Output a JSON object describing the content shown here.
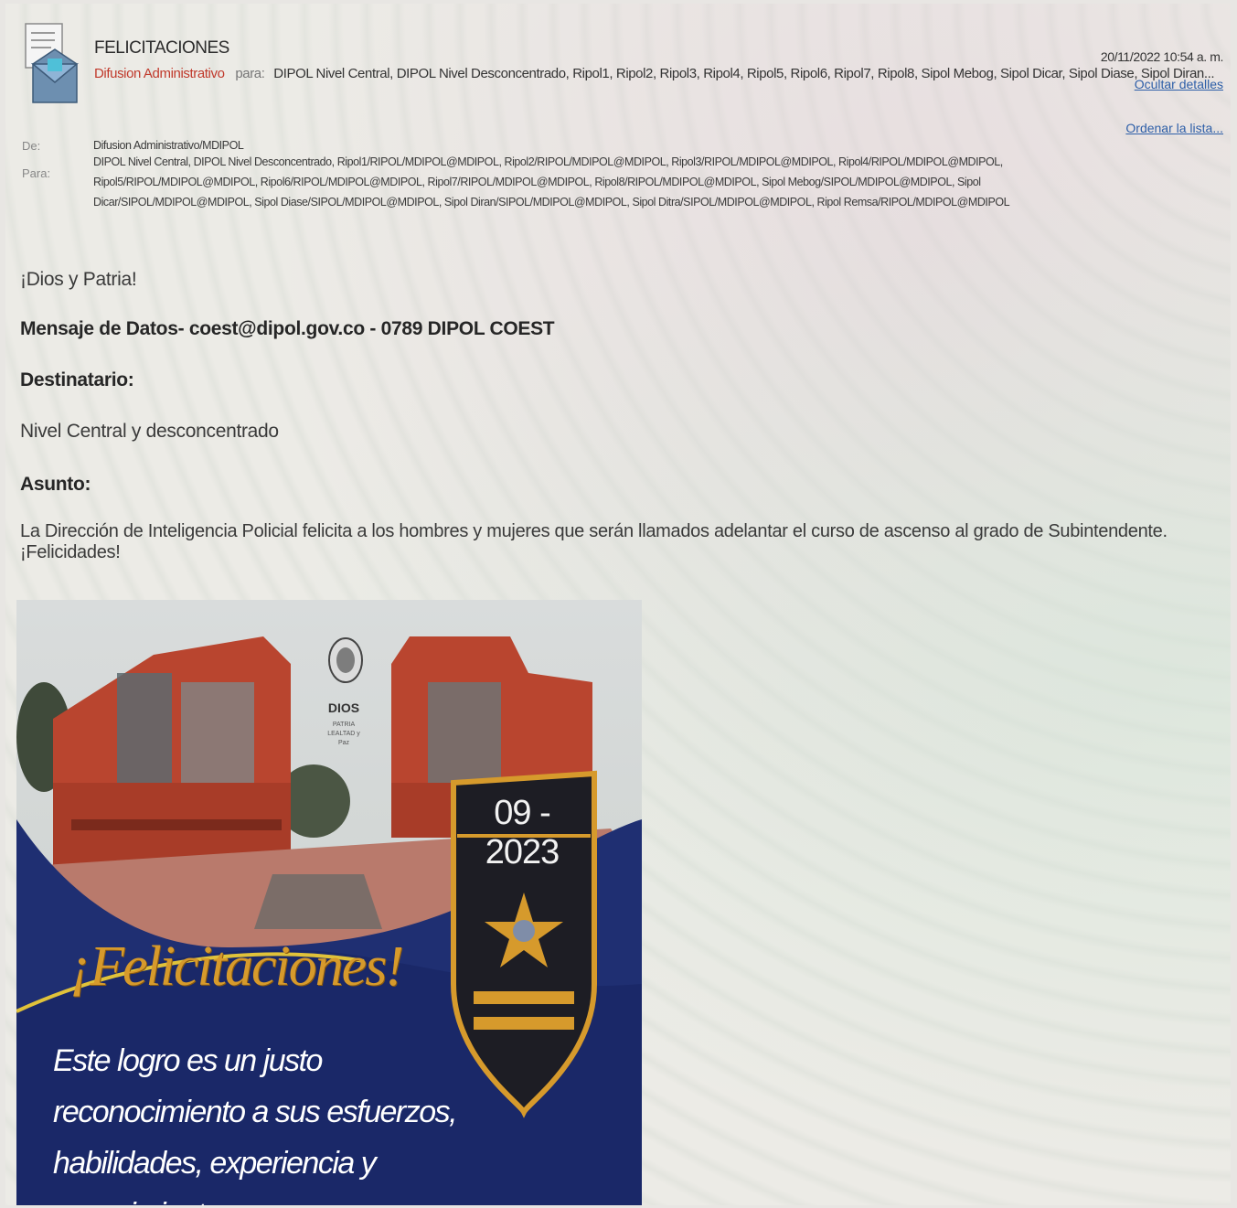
{
  "header": {
    "subject": "FELICITACIONES",
    "from_name": "Difusion Administrativo",
    "para_label": "para:",
    "to_summary": "DIPOL Nivel Central, DIPOL Nivel Desconcentrado, Ripol1, Ripol2, Ripol3, Ripol4, Ripol5, Ripol6, Ripol7, Ripol8, Sipol Mebog, Sipol Dicar, Sipol Diase, Sipol Diran...",
    "date": "20/11/2022 10:54 a. m.",
    "hide_details": "Ocultar detalles",
    "sort_list": "Ordenar la lista..."
  },
  "details": {
    "from_label": "De:",
    "from_value": "Difusion Administrativo/MDIPOL",
    "to_label": "Para:",
    "to_value": "DIPOL Nivel Central, DIPOL Nivel Desconcentrado, Ripol1/RIPOL/MDIPOL@MDIPOL, Ripol2/RIPOL/MDIPOL@MDIPOL, Ripol3/RIPOL/MDIPOL@MDIPOL, Ripol4/RIPOL/MDIPOL@MDIPOL, Ripol5/RIPOL/MDIPOL@MDIPOL, Ripol6/RIPOL/MDIPOL@MDIPOL, Ripol7/RIPOL/MDIPOL@MDIPOL, Ripol8/RIPOL/MDIPOL@MDIPOL, Sipol Mebog/SIPOL/MDIPOL@MDIPOL, Sipol Dicar/SIPOL/MDIPOL@MDIPOL, Sipol Diase/SIPOL/MDIPOL@MDIPOL, Sipol Diran/SIPOL/MDIPOL@MDIPOL, Sipol Ditra/SIPOL/MDIPOL@MDIPOL, Ripol Remsa/RIPOL/MDIPOL@MDIPOL"
  },
  "body": {
    "greeting": "¡Dios y Patria!",
    "message_label": "Mensaje de Datos- coest@dipol.gov.co - 0789 DIPOL COEST",
    "recipient_label": "Destinatario:",
    "recipient_value": "Nivel Central y desconcentrado",
    "subject_label": "Asunto:",
    "subject_value": "La Dirección de Inteligencia Policial felicita a los hombres y mujeres que serán llamados adelantar el curso de ascenso al grado de Subintendente. ¡Felicidades!"
  },
  "banner": {
    "title": "¡Felicitaciones!",
    "badge_date": "09 - 2023",
    "emblem_text": "DIOS",
    "emblem_sub": "PATRIA LEALTAD y Paz",
    "message": "Este logro es un justo reconocimiento a sus esfuerzos, habilidades, experiencia y conocimiento."
  },
  "colors": {
    "accent_red": "#c0392b",
    "link_blue": "#2e5fa8",
    "banner_navy": "#1f2f72",
    "badge_gold": "#d69a2c",
    "building_red": "#b9452f"
  }
}
